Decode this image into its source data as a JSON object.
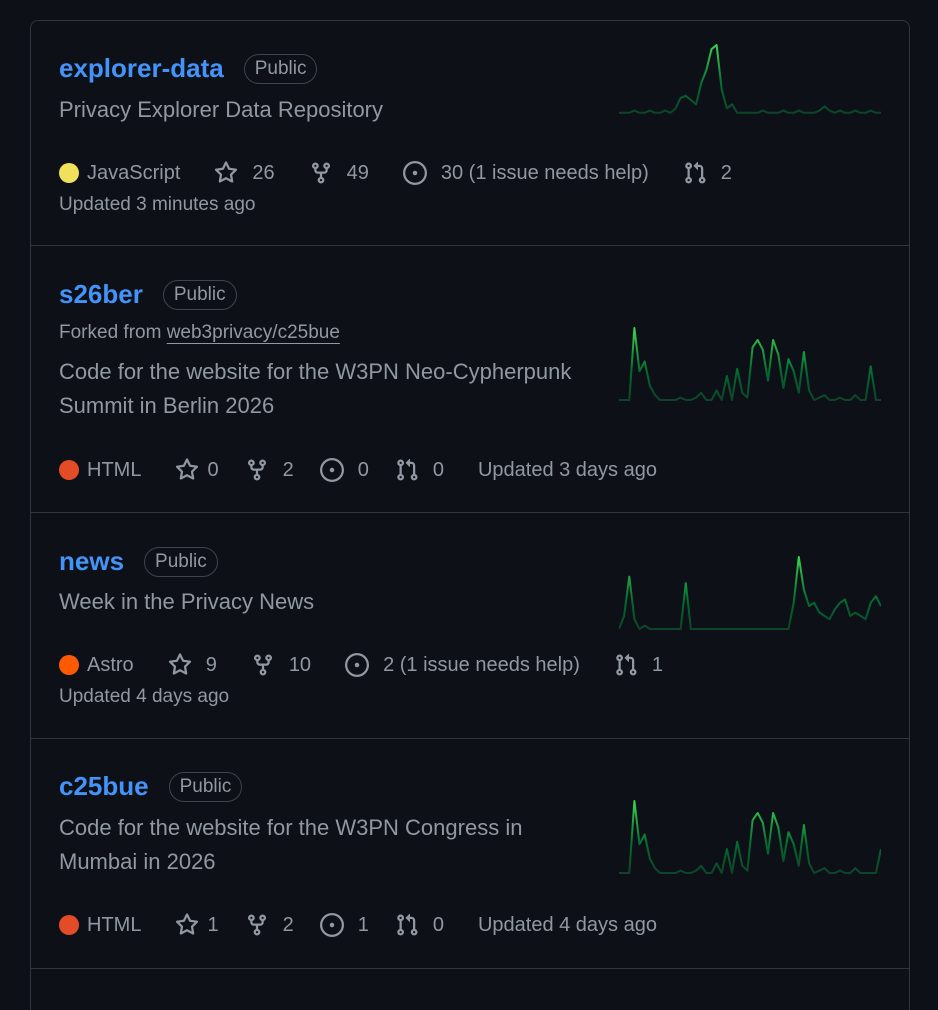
{
  "colors": {
    "link": "#4493f8",
    "text_muted": "#9198a1",
    "border": "#30363d",
    "spark": "#3fb950"
  },
  "repos": [
    {
      "name": "explorer-data",
      "visibility": "Public",
      "description": "Privacy Explorer Data Repository",
      "language": "JavaScript",
      "language_color": "#f1e05a",
      "stars": "26",
      "forks": "49",
      "issues": "30 (1 issue needs help)",
      "pulls": "2",
      "updated": "Updated 3 minutes ago",
      "activity": [
        2,
        2,
        2,
        3,
        2,
        2,
        3,
        2,
        2,
        3,
        2,
        4,
        9,
        10,
        8,
        6,
        16,
        22,
        32,
        34,
        13,
        4,
        6,
        2,
        2,
        2,
        2,
        2,
        3,
        2,
        2,
        2,
        3,
        2,
        2,
        3,
        2,
        2,
        2,
        3,
        5,
        3,
        2,
        3,
        2,
        2,
        3,
        2,
        2,
        3,
        2,
        2
      ]
    },
    {
      "name": "s26ber",
      "visibility": "Public",
      "forked_from_label": "Forked from ",
      "forked_from": "web3privacy/c25bue",
      "description": "Code for the website for the W3PN Neo-Cypherpunk Summit in Berlin 2026",
      "language": "HTML",
      "language_color": "#e34c26",
      "stars": "0",
      "forks": "2",
      "issues": "0",
      "pulls": "0",
      "updated": "Updated 3 days ago",
      "activity": [
        0,
        0,
        0,
        30,
        12,
        16,
        6,
        2,
        0,
        0,
        0,
        0,
        1,
        0,
        0,
        1,
        3,
        0,
        0,
        4,
        0,
        10,
        0,
        13,
        3,
        1,
        22,
        25,
        21,
        8,
        25,
        19,
        5,
        17,
        12,
        3,
        20,
        4,
        0,
        1,
        2,
        0,
        0,
        1,
        0,
        0,
        2,
        0,
        0,
        14,
        0,
        0
      ]
    },
    {
      "name": "news",
      "visibility": "Public",
      "description": "Week in the Privacy News",
      "language": "Astro",
      "language_color": "#ff5a03",
      "stars": "9",
      "forks": "10",
      "issues": "2 (1 issue needs help)",
      "pulls": "1",
      "updated": "Updated 4 days ago",
      "activity": [
        0,
        4,
        16,
        3,
        0,
        1,
        0,
        0,
        0,
        0,
        0,
        0,
        0,
        14,
        0,
        0,
        0,
        0,
        0,
        0,
        0,
        0,
        0,
        0,
        0,
        0,
        0,
        0,
        0,
        0,
        0,
        0,
        0,
        0,
        8,
        22,
        12,
        7,
        8,
        5,
        4,
        3,
        6,
        8,
        9,
        4,
        5,
        4,
        3,
        8,
        10,
        7
      ]
    },
    {
      "name": "c25bue",
      "visibility": "Public",
      "description": "Code for the website for the W3PN Congress in Mumbai in 2026",
      "language": "HTML",
      "language_color": "#e34c26",
      "stars": "1",
      "forks": "2",
      "issues": "1",
      "pulls": "0",
      "updated": "Updated 4 days ago",
      "activity": [
        0,
        0,
        0,
        30,
        12,
        16,
        6,
        2,
        0,
        0,
        0,
        0,
        1,
        0,
        0,
        1,
        3,
        0,
        0,
        4,
        0,
        10,
        0,
        13,
        3,
        1,
        22,
        25,
        21,
        8,
        25,
        19,
        5,
        17,
        12,
        3,
        20,
        4,
        0,
        1,
        2,
        0,
        0,
        1,
        0,
        0,
        2,
        0,
        0,
        0,
        0,
        10
      ]
    }
  ]
}
